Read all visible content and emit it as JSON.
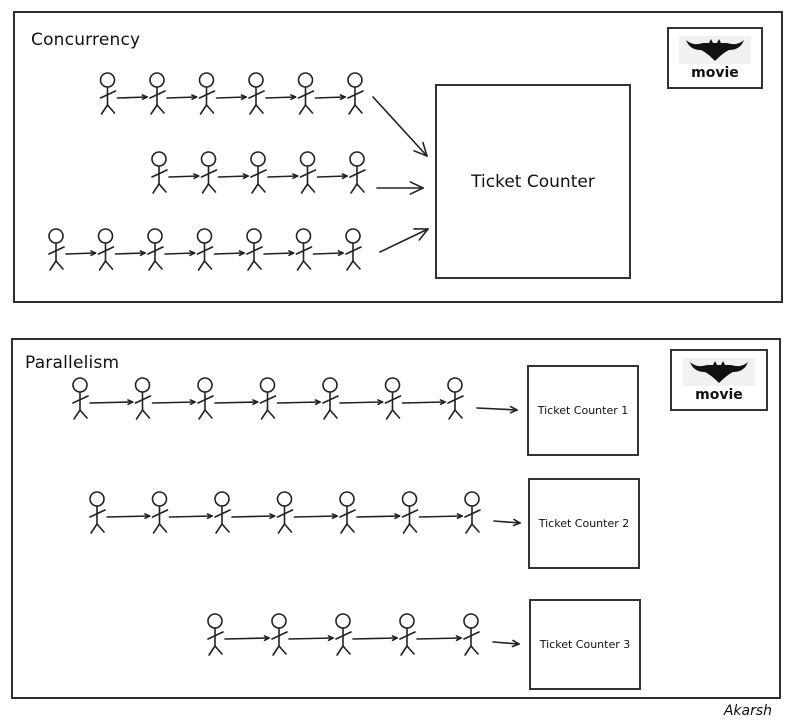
{
  "sections": {
    "concurrency": {
      "title": "Concurrency",
      "counter_label": "Ticket Counter",
      "movie_label": "movie",
      "queues": [
        {
          "people": 6
        },
        {
          "people": 5
        },
        {
          "people": 7
        }
      ]
    },
    "parallelism": {
      "title": "Parallelism",
      "movie_label": "movie",
      "counters": [
        {
          "label": "Ticket Counter 1",
          "people": 7
        },
        {
          "label": "Ticket Counter 2",
          "people": 7
        },
        {
          "label": "Ticket Counter 3",
          "people": 5
        }
      ]
    }
  },
  "author": "Akarsh",
  "icons": {
    "movie_logo": "bat-icon",
    "figure": "stick-figure-icon",
    "arrow": "arrow-right-icon"
  }
}
